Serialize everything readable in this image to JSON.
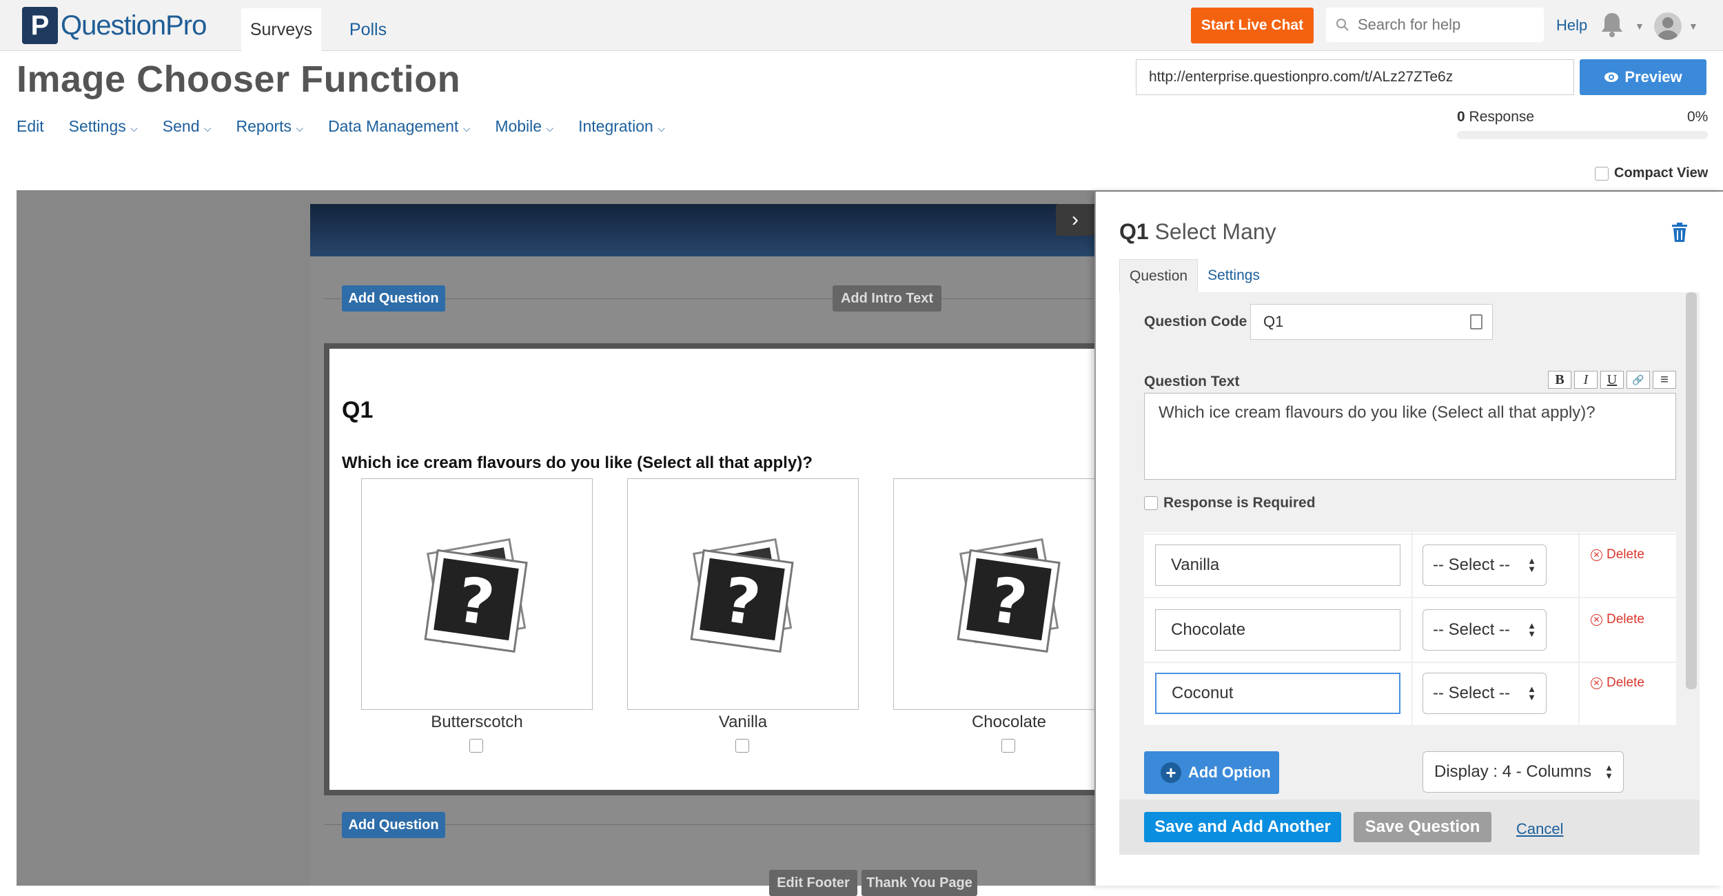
{
  "topbar": {
    "logo_letter": "P",
    "logo_text": "QuestionPro",
    "tabs": [
      {
        "label": "Surveys"
      },
      {
        "label": "Polls"
      }
    ],
    "chat_button": "Start Live Chat",
    "search_placeholder": "Search for help",
    "help": "Help"
  },
  "header": {
    "title": "Image Chooser Function",
    "url": "http://enterprise.questionpro.com/t/ALz27ZTe6z",
    "preview": "Preview",
    "menu": [
      "Edit",
      "Settings",
      "Send",
      "Reports",
      "Data Management",
      "Mobile",
      "Integration"
    ],
    "response_count": "0",
    "response_label": "Response",
    "response_percent": "0%",
    "response_progress": 0,
    "compact_view": "Compact View"
  },
  "survey": {
    "add_question": "Add Question",
    "add_intro": "Add Intro Text",
    "question_number": "Q1",
    "question_text": "Which ice cream flavours do you like (Select all that apply)?",
    "images": [
      {
        "label": "Butterscotch"
      },
      {
        "label": "Vanilla"
      },
      {
        "label": "Chocolate"
      }
    ],
    "add_question_bottom": "Add Question",
    "edit_footer": "Edit Footer",
    "thank_you": "Thank You Page"
  },
  "panel": {
    "q_code": "Q1",
    "q_type": "Select Many",
    "tabs": [
      {
        "label": "Question"
      },
      {
        "label": "Settings"
      }
    ],
    "code_label": "Question Code",
    "code_value": "Q1",
    "text_label": "Question Text",
    "format_buttons": [
      "B",
      "I",
      "U",
      "🔗",
      "≡"
    ],
    "text_value": "Which ice cream flavours do you like (Select all that apply)?",
    "required_label": "Response is Required",
    "options": [
      {
        "value": "Vanilla",
        "select": "-- Select --",
        "delete": "Delete"
      },
      {
        "value": "Chocolate",
        "select": "-- Select --",
        "delete": "Delete"
      },
      {
        "value": "Coconut",
        "select": "-- Select --",
        "delete": "Delete"
      }
    ],
    "add_option": "Add Option",
    "display": "Display : 4 - Columns",
    "save_add": "Save and Add Another",
    "save": "Save Question",
    "cancel": "Cancel"
  },
  "colors": {
    "brand_blue": "#1f5d96",
    "chat_orange": "#f5620f",
    "preview_blue": "#3b8ad9",
    "delete_red": "#d9362c"
  }
}
